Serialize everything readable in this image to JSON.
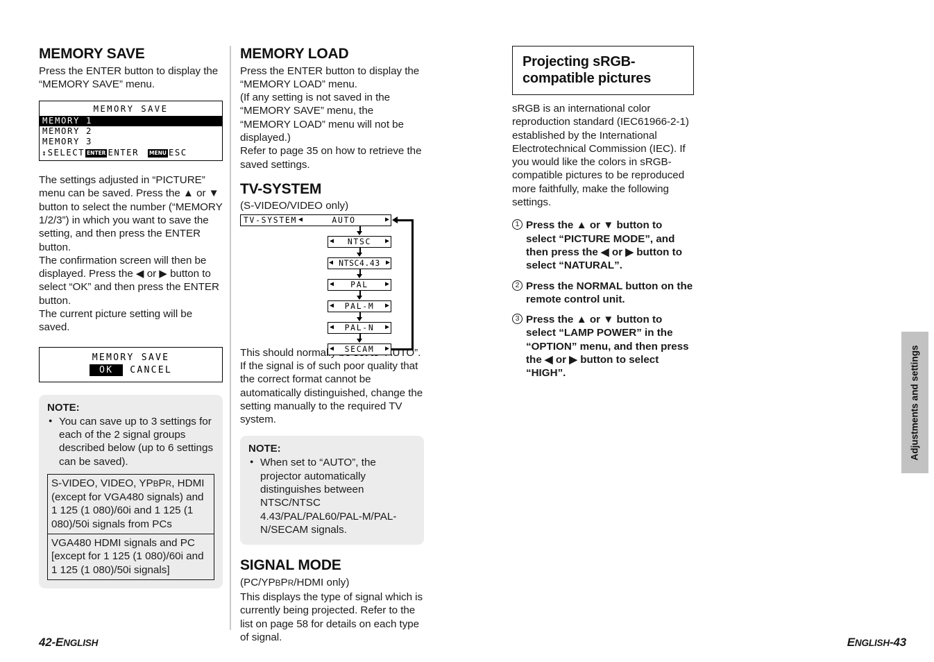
{
  "left_column": {
    "heading": "MEMORY SAVE",
    "intro": "Press the ENTER button to display the “MEMORY SAVE” menu.",
    "osd_menu": {
      "title": "MEMORY SAVE",
      "items": [
        "MEMORY 1",
        "MEMORY 2",
        "MEMORY 3"
      ],
      "selected_index": 0,
      "footer": {
        "updown_icon": "up-down-arrow-icon",
        "select_label": "SELECT",
        "enter_key": "ENTER",
        "enter_label": "ENTER",
        "menu_key": "MENU",
        "esc_label": "ESC"
      }
    },
    "body": "The settings adjusted in “PICTURE” menu can be saved. Press the ▲ or ▼ button to select the number (“MEMORY 1/2/3”) in which you want to save the setting, and then press the ENTER button.\nThe confirmation screen will then be displayed. Press the ◀ or ▶ button to select “OK” and then press the ENTER button.\nThe current picture setting will be saved.",
    "osd_confirm": {
      "title": "MEMORY SAVE",
      "ok_label": "OK",
      "cancel_label": "CANCEL",
      "selected": "OK"
    },
    "note": {
      "title": "NOTE:",
      "items": [
        "You can save up to 3 settings for each of the 2 signal groups described below (up to 6 settings can be saved)."
      ],
      "groups": [
        "S-VIDEO, VIDEO, YPBPR, HDMI (except for VGA480 signals) and 1 125 (1 080)/60i and 1 125 (1 080)/50i signals from PCs",
        "VGA480 HDMI signals and PC [except for 1 125 (1 080)/60i and 1 125 (1 080)/50i signals]"
      ]
    }
  },
  "middle_column": {
    "memory_load": {
      "heading": "MEMORY LOAD",
      "body": "Press the ENTER button to display the “MEMORY LOAD” menu.\n(If any setting is not saved in the “MEMORY SAVE” menu, the “MEMORY LOAD” menu will not be displayed.)\nRefer to page 35 on how to retrieve the saved settings."
    },
    "tv_system": {
      "heading": "TV-SYSTEM",
      "subheading": "(S-VIDEO/VIDEO only)",
      "menu_label": "TV-SYSTEM",
      "options": [
        "AUTO",
        "NTSC",
        "NTSC4.43",
        "PAL",
        "PAL-M",
        "PAL-N",
        "SECAM"
      ],
      "left_arrow": "◀",
      "right_arrow": "▶",
      "body": "This should normally be set to “AUTO”. If the signal is of such poor quality that the correct format cannot be automatically distinguished, change the setting manually to the required TV system.",
      "note": {
        "title": "NOTE:",
        "items": [
          "When set to “AUTO”, the projector automatically distinguishes between NTSC/NTSC 4.43/PAL/PAL60/PAL-M/PAL-N/SECAM signals."
        ]
      }
    },
    "signal_mode": {
      "heading": "SIGNAL MODE",
      "subheading": "(PC/YPBPR/HDMI only)",
      "body": "This displays the type of signal which is currently being projected. Refer to the list on page 58 for details on each type of signal."
    }
  },
  "right_column": {
    "title_box": {
      "line1": "Projecting sRGB-",
      "line2": "compatible pictures"
    },
    "intro": "sRGB is an international color reproduction standard (IEC61966-2-1) established by the International Electrotechnical Commission (IEC). If you would like the colors in sRGB-compatible pictures to be reproduced more faithfully, make the following settings.",
    "steps": [
      {
        "num": "1",
        "text": "Press the ▲ or ▼ button to select “PICTURE MODE”, and then press the ◀ or ▶ button to select “NATURAL”."
      },
      {
        "num": "2",
        "text": "Press the NORMAL button on the remote control unit."
      },
      {
        "num": "3",
        "text": "Press the ▲ or ▼ button to select “LAMP POWER” in the “OPTION” menu, and then press the ◀ or ▶ button to select “HIGH”."
      }
    ]
  },
  "side_tab": {
    "label": "Adjustments and settings"
  },
  "footer": {
    "left_page": "42-",
    "left_lang": "ENGLISH",
    "right_lang": "ENGLISH",
    "right_page": "-43"
  },
  "colors": {
    "note_bg": "#ececec",
    "side_tab_bg": "#c2c2c2",
    "divider": "#c9c9c9",
    "text": "#1a1a1a"
  }
}
